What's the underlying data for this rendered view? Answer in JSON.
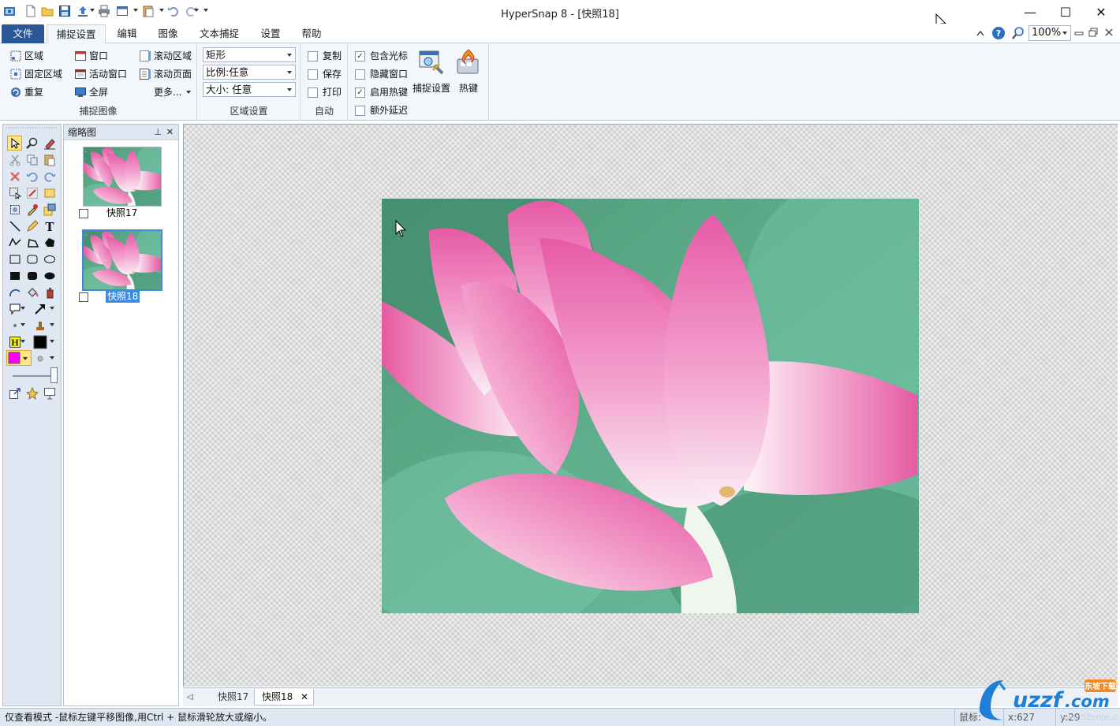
{
  "window": {
    "title": "HyperSnap 8 - [快照18]",
    "minimize_glyph": "—",
    "maximize_glyph": "☐",
    "close_glyph": "✕"
  },
  "ribbon": {
    "tabs": [
      "文件",
      "捕捉设置",
      "编辑",
      "图像",
      "文本捕捉",
      "设置",
      "帮助"
    ],
    "active_tab": "捕捉设置",
    "zoom": "100%",
    "capture_group": {
      "label": "捕捉图像",
      "items": [
        "区域",
        "固定区域",
        "重复",
        "窗口",
        "活动窗口",
        "全屏",
        "滚动区域",
        "滚动页面",
        "更多..."
      ]
    },
    "region_group": {
      "label": "区域设置",
      "shape": "矩形",
      "ratio": "比例:任意",
      "size": "大小: 任意"
    },
    "auto_group": {
      "label": "自动",
      "options": [
        {
          "label": "复制",
          "checked": false
        },
        {
          "label": "保存",
          "checked": false
        },
        {
          "label": "打印",
          "checked": false
        }
      ]
    },
    "options_group": {
      "options": [
        {
          "label": "包含光标",
          "checked": true
        },
        {
          "label": "隐藏窗口",
          "checked": false
        },
        {
          "label": "启用热键",
          "checked": true
        },
        {
          "label": "额外延迟",
          "checked": false
        }
      ]
    },
    "buttons": {
      "capture_settings": "捕捉设置",
      "hotkeys": "热键"
    }
  },
  "thumbnails": {
    "title": "缩略图",
    "pin_glyph": "⊥",
    "close_glyph": "✕",
    "items": [
      {
        "label": "快照17",
        "checked": false,
        "selected": false
      },
      {
        "label": "快照18",
        "checked": false,
        "selected": true
      }
    ]
  },
  "doc_tabs": {
    "items": [
      "快照17",
      "快照18"
    ],
    "active": "快照18",
    "close_glyph": "✕",
    "left_arrow": "◁"
  },
  "status": {
    "message": "仅查看模式 -鼠标左键平移图像,用Ctrl + 鼠标滑轮放大或缩小。",
    "mouse_label": "鼠标:",
    "x": "x:627",
    "y": "y:29"
  },
  "watermark": {
    "brand": "uzzf.com",
    "badge": "东坡下载",
    "url": "www.52pojie.cn"
  },
  "colors": {
    "accent": "#2b5797",
    "selection": "#3d8be0",
    "canvas": "#cfcfcf",
    "toolbox": "#dfe7f2",
    "magenta": "#ff00ff"
  },
  "icons": [
    "app-icon",
    "new-icon",
    "open-icon",
    "save-icon",
    "upload-icon",
    "print-icon",
    "undo-icon",
    "redo-icon",
    "help-icon",
    "zoom-icon"
  ]
}
